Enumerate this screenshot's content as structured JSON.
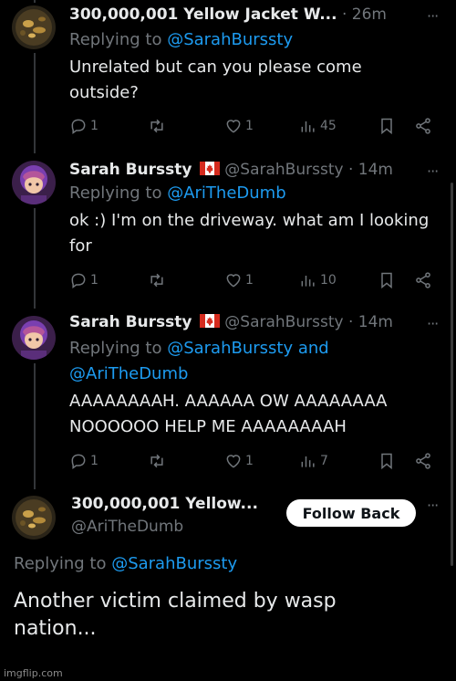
{
  "colors": {
    "background": "#000000",
    "text": "#e7e9ea",
    "muted": "#71767b",
    "link": "#1d9bf0"
  },
  "tweets": [
    {
      "name": "300,000,001 Yellow Jacket W...",
      "meta": "· 26m",
      "reply_prefix": "Replying to ",
      "reply_links": [
        "@SarahBurssty"
      ],
      "text_lines": [
        "Unrelated but can you please come",
        "outside?"
      ],
      "stats": {
        "replies": "1",
        "retweets": "",
        "likes": "1",
        "views": "45"
      }
    },
    {
      "name": "Sarah Burssty",
      "flag_icon": "canada-flag-icon",
      "meta": "@SarahBurssty · 14m",
      "reply_prefix": "Replying to ",
      "reply_links": [
        "@AriTheDumb"
      ],
      "text_lines": [
        "ok :) I'm on the driveway. what am I looking",
        "for"
      ],
      "stats": {
        "replies": "1",
        "retweets": "",
        "likes": "1",
        "views": "10"
      }
    },
    {
      "name": "Sarah Burssty",
      "flag_icon": "canada-flag-icon",
      "meta": "@SarahBurssty · 14m",
      "reply_prefix": "Replying to ",
      "reply_links": [
        "@SarahBurssty and",
        "@AriTheDumb"
      ],
      "text_lines": [
        "AAAAAAAAH. AAAAAA OW AAAAAAAA",
        "NOOOOOO HELP ME AAAAAAAAH"
      ],
      "stats": {
        "replies": "1",
        "retweets": "",
        "likes": "1",
        "views": "7"
      }
    }
  ],
  "main_tweet": {
    "name": "300,000,001 Yellow...",
    "handle": "@AriTheDumb",
    "follow_label": "Follow Back",
    "reply_prefix": "Replying to ",
    "reply_link": "@SarahBurssty",
    "text_lines": [
      "Another victim claimed by wasp",
      "nation..."
    ]
  },
  "icons": [
    "reply-icon",
    "retweet-icon",
    "like-icon",
    "views-icon",
    "bookmark-icon",
    "share-icon",
    "more-icon"
  ],
  "watermark": "imgflip.com"
}
